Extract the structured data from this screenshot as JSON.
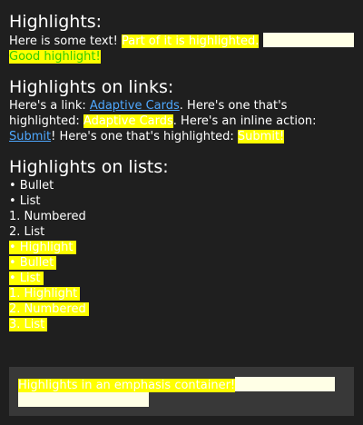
{
  "highlights": {
    "title": "Highlights:",
    "plain_text": "Here is some text! ",
    "highlighted_text": "Part of it is highlighted.",
    "good_highlight": "Good highlight!"
  },
  "links": {
    "title": "Highlights on links:",
    "p1": "Here's a link: ",
    "link1": "Adaptive Cards",
    "p2": ". Here's one that's highlighted: ",
    "link2": "Adaptive Cards",
    "p3": ". Here's an inline action: ",
    "action1": "Submit",
    "p4": "! Here's one that's highlighted: ",
    "action2": "Submit!"
  },
  "lists": {
    "title": "Highlights on lists:",
    "items": [
      "• Bullet",
      "• List",
      "1. Numbered",
      "2. List"
    ],
    "highlighted_items": [
      "• Highlight",
      "• Bullet",
      "• List",
      "1. Highlight",
      "2. Numbered",
      "3. List"
    ]
  },
  "emphasis": {
    "text": "Highlights in an emphasis container!"
  },
  "colors": {
    "background": "#1f1f1f",
    "highlight": "#ffff00",
    "highlight_blank": "#ffffe6",
    "good_highlight_text": "#33cc00",
    "link": "#4ea8ff",
    "emphasis_background": "#383838"
  }
}
